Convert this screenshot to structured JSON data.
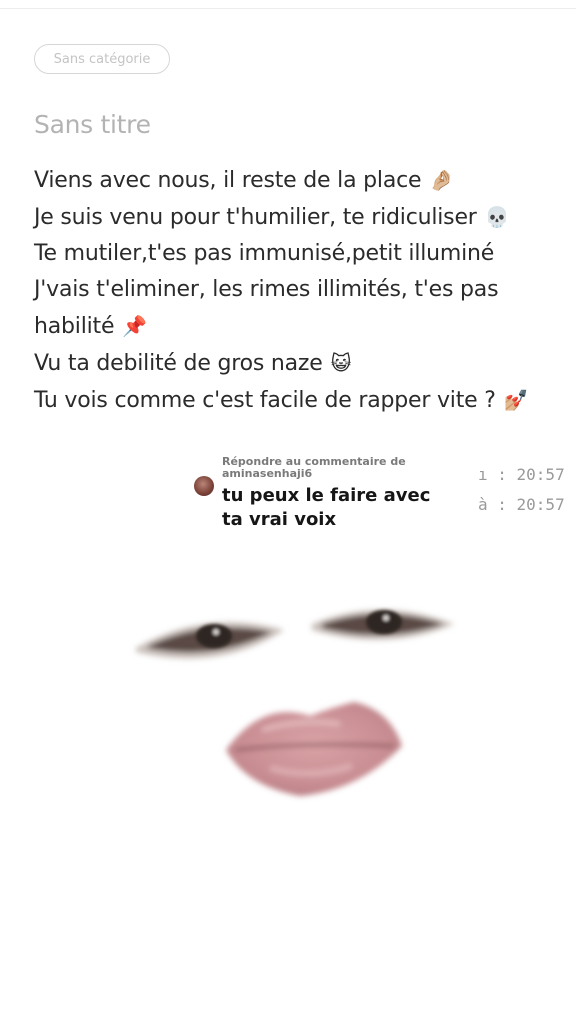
{
  "note": {
    "category": "Sans catégorie",
    "title": "Sans titre",
    "lines": [
      {
        "text": "Viens avec nous, il reste de la place",
        "emoji": "🤌🏼"
      },
      {
        "text": "Je suis venu pour t'humilier, te ridiculiser",
        "emoji": "💀"
      },
      {
        "text": "Te mutiler,t'es pas immunisé,petit illuminé",
        "emoji": ""
      },
      {
        "text": "J'vais t'eliminer, les rimes illimités, t'es pas",
        "emoji": ""
      },
      {
        "text": "habilité",
        "emoji": "📌"
      },
      {
        "text": "Vu ta debilité de gros naze",
        "emoji": "😺"
      },
      {
        "text": "Tu vois comme c'est facile de rapper vite ?",
        "emoji": "💅🏼"
      }
    ]
  },
  "reply": {
    "label": "Répondre au commentaire de aminasenhaji6",
    "comment": "tu peux le faire avec ta vrai voix"
  },
  "timestamps": [
    "ı : 20:57",
    "à : 20:57"
  ],
  "colors": {
    "lips": "#c98e93",
    "eyes": "#4a3a35"
  }
}
